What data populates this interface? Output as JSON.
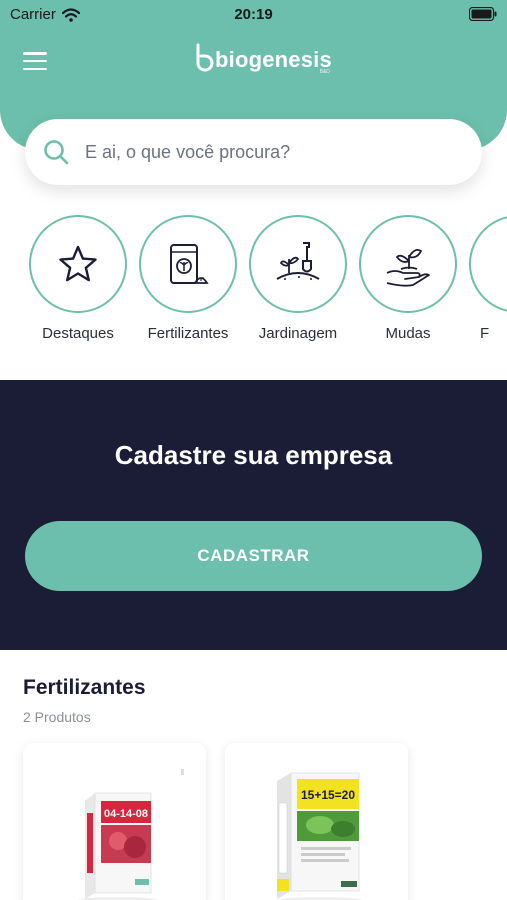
{
  "status_bar": {
    "carrier": "Carrier",
    "time": "20:19"
  },
  "header": {
    "logo_text": "biogenesis",
    "logo_sub": "B&D",
    "menu_icon": "hamburger-icon"
  },
  "search": {
    "placeholder": "E ai, o que você procura?",
    "value": ""
  },
  "categories": [
    {
      "label": "Destaques",
      "icon": "star-icon"
    },
    {
      "label": "Fertilizantes",
      "icon": "fertilizer-bag-icon"
    },
    {
      "label": "Jardinagem",
      "icon": "shovel-plant-icon"
    },
    {
      "label": "Mudas",
      "icon": "seedling-hand-icon"
    },
    {
      "label": "F",
      "icon": "partial-icon"
    }
  ],
  "banner": {
    "title": "Cadastre sua empresa",
    "button_label": "CADASTRAR"
  },
  "section": {
    "title": "Fertilizantes",
    "count": "2 Produtos"
  },
  "products": [
    {
      "label": "04-14-08",
      "band_color": "#d7263d"
    },
    {
      "label": "15+15=20",
      "band_color": "#f2e21f"
    }
  ],
  "colors": {
    "primary": "#6cbfac",
    "banner": "#1b1d36"
  }
}
